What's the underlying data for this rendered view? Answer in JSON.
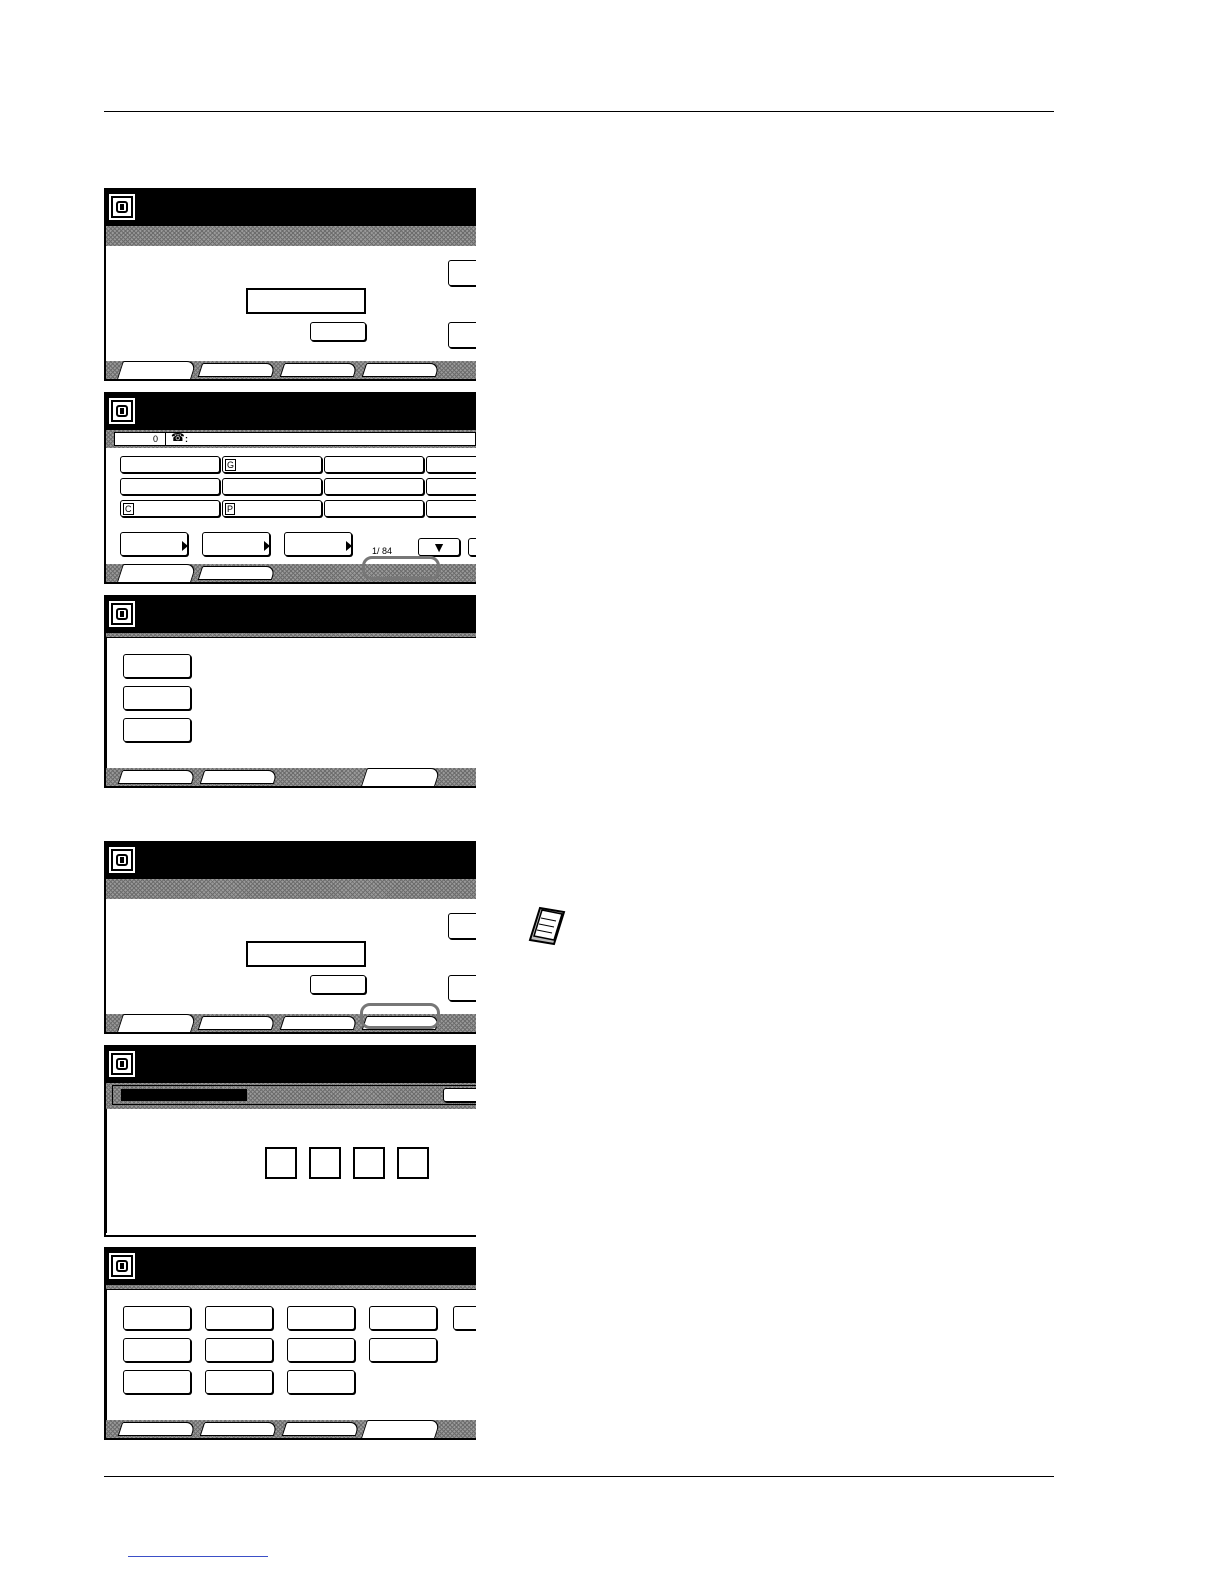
{
  "page": {
    "rules": 2
  },
  "panels": [
    {
      "id": "panel-1",
      "icon": "fax-machine-icon"
    },
    {
      "id": "panel-2",
      "icon": "fax-machine-icon",
      "status": {
        "count": "0",
        "phone_symbol": "☎",
        "separator": ":"
      },
      "grid_badges": {
        "g": "G",
        "c": "C",
        "p": "P"
      },
      "page_indicator": "1/ 84",
      "down_arrow": "▼"
    },
    {
      "id": "panel-3",
      "icon": "fax-machine-icon"
    },
    {
      "id": "panel-4",
      "icon": "fax-machine-icon"
    },
    {
      "id": "panel-5",
      "icon": "fax-machine-icon"
    },
    {
      "id": "panel-6",
      "icon": "fax-machine-icon"
    }
  ],
  "note": {
    "icon": "note-pad-icon"
  }
}
